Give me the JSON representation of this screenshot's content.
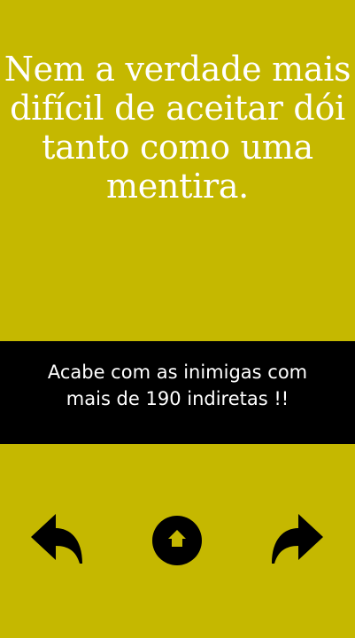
{
  "quote": {
    "lines": [
      "Nem a verdade mais",
      "difícil de aceitar dói",
      "tanto como uma",
      "mentira."
    ]
  },
  "ad": {
    "line1": "Acabe com as inimigas com",
    "line2": "mais de 190 indiretas !!"
  },
  "nav": {
    "back_icon": "reply-arrow-left-icon",
    "home_icon": "home-icon",
    "next_icon": "forward-arrow-right-icon"
  },
  "colors": {
    "background": "#c5b800",
    "banner": "#000000",
    "text": "#ffffff",
    "icons": "#000000"
  }
}
